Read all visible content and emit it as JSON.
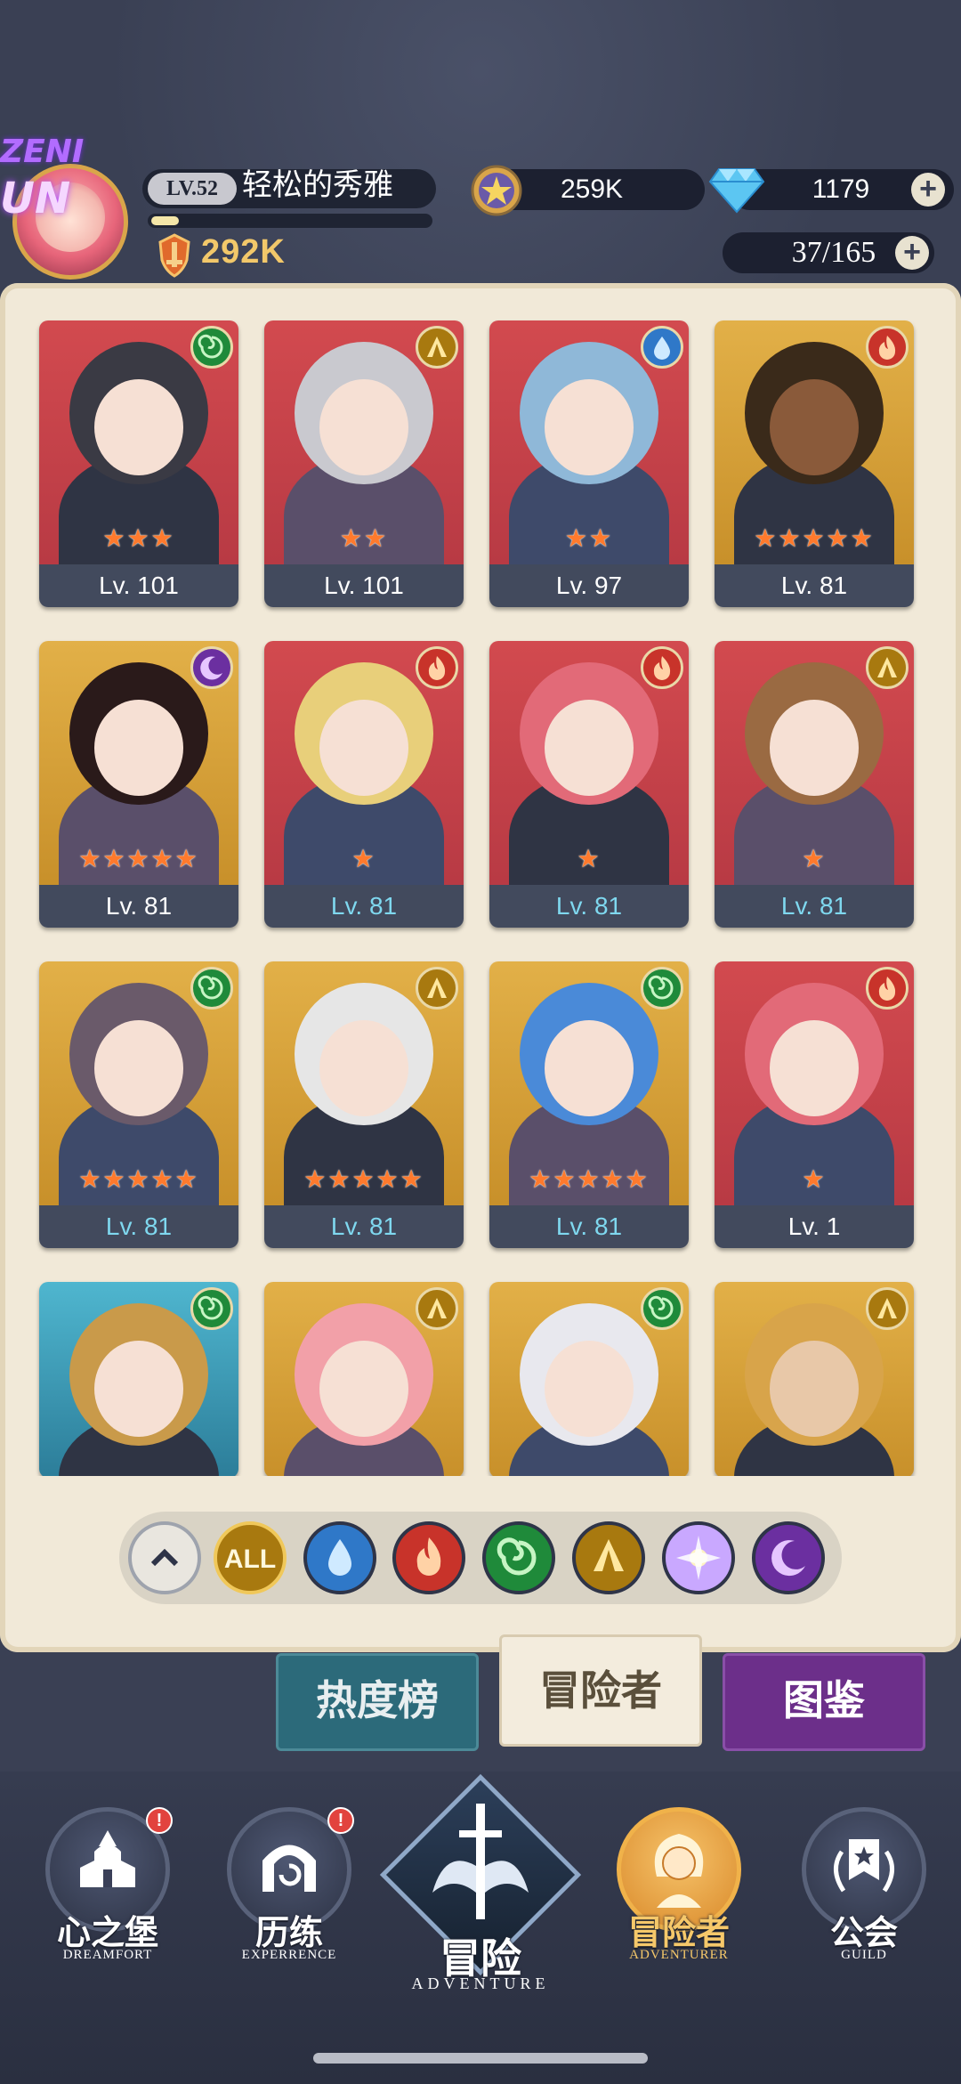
{
  "player": {
    "level": "LV.52",
    "name": "轻松的秀雅",
    "power": "292K",
    "exp_fraction": 0.1,
    "logo_text_top": "ZENI",
    "logo_text_bottom": "UN"
  },
  "currency": {
    "gold": "259K",
    "gems": "1179",
    "roster": "37/165"
  },
  "heroes": [
    {
      "level": "Lv. 101",
      "stars": "★★★",
      "element": "wind"
    },
    {
      "level": "Lv. 101",
      "stars": "★★",
      "element": "earth"
    },
    {
      "level": "Lv. 97",
      "stars": "★★",
      "element": "water"
    },
    {
      "level": "Lv. 81",
      "stars": "★★★★★",
      "element": "fire"
    },
    {
      "level": "Lv. 81",
      "stars": "★★★★★",
      "element": "dark"
    },
    {
      "level": "Lv. 81",
      "stars": "★",
      "element": "fire"
    },
    {
      "level": "Lv. 81",
      "stars": "★",
      "element": "fire"
    },
    {
      "level": "Lv. 81",
      "stars": "★",
      "element": "earth"
    },
    {
      "level": "Lv. 81",
      "stars": "★★★★★",
      "element": "wind"
    },
    {
      "level": "Lv. 81",
      "stars": "★★★★★",
      "element": "earth"
    },
    {
      "level": "Lv. 81",
      "stars": "★★★★★",
      "element": "wind"
    },
    {
      "level": "Lv. 1",
      "stars": "★",
      "element": "fire"
    },
    {
      "element": "wind"
    },
    {
      "element": "earth"
    },
    {
      "element": "wind"
    },
    {
      "element": "earth"
    }
  ],
  "filters": {
    "all_label": "ALL",
    "items": [
      "collapse",
      "all",
      "water",
      "fire",
      "wind",
      "earth",
      "light",
      "dark"
    ]
  },
  "tabs": {
    "popularity": "热度榜",
    "adventurer": "冒险者",
    "codex": "图鉴"
  },
  "nav": [
    {
      "label": "心之堡",
      "sub": "DREAMFORT",
      "badge": "!"
    },
    {
      "label": "历练",
      "sub": "EXPERRENCE",
      "badge": "!"
    },
    {
      "label": "冒险",
      "sub": "ADVENTURE"
    },
    {
      "label": "冒险者",
      "sub": "ADVENTURER"
    },
    {
      "label": "公会",
      "sub": "GUILD"
    }
  ],
  "colors": {
    "water": "#2f78c8",
    "fire": "#c8332a",
    "wind": "#1f8a3a",
    "earth": "#a8790f",
    "light": "#c9a8ff",
    "dark": "#6b2fa0",
    "level_highlight": "#7fd8ef",
    "level_normal": "#ffffff"
  }
}
